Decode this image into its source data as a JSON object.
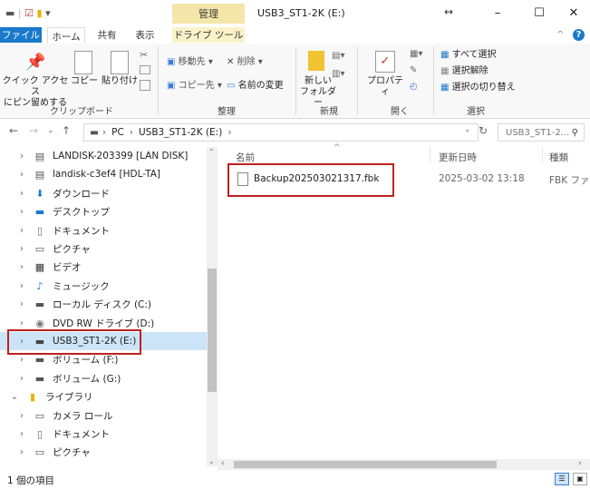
{
  "titlebar": {
    "manage_tab": "管理",
    "window_title": "USB3_ST1-2K (E:)",
    "min": "–",
    "max": "☐",
    "close": "✕",
    "resize_arrows": "↔"
  },
  "ribbon_tabs": {
    "file": "ファイル",
    "home": "ホーム",
    "share": "共有",
    "view": "表示",
    "drive_tools": "ドライブ ツール",
    "help": "?"
  },
  "ribbon": {
    "clipboard": {
      "pin_line1": "クイック アクセス",
      "pin_line2": "にピン留めする",
      "copy": "コピー",
      "paste": "貼り付け",
      "group": "クリップボード"
    },
    "organize": {
      "move_to": "移動先",
      "copy_to": "コピー先",
      "delete": "削除",
      "rename": "名前の変更",
      "group": "整理"
    },
    "new": {
      "new_folder_line1": "新しい",
      "new_folder_line2": "フォルダー",
      "group": "新規"
    },
    "open": {
      "properties": "プロパティ",
      "group": "開く"
    },
    "select": {
      "select_all": "すべて選択",
      "select_none": "選択解除",
      "invert": "選択の切り替え",
      "group": "選択"
    }
  },
  "address": {
    "crumb_pc": "PC",
    "crumb_drive": "USB3_ST1-2K (E:)",
    "search_placeholder": "USB3_ST1-2..."
  },
  "nav": {
    "items": [
      {
        "label": "LANDISK-203399 [LAN DISK]",
        "icon": "network-server-icon"
      },
      {
        "label": "landisk-c3ef4 [HDL-TA]",
        "icon": "network-server-icon"
      },
      {
        "label": "ダウンロード",
        "icon": "download-arrow-icon"
      },
      {
        "label": "デスクトップ",
        "icon": "desktop-icon"
      },
      {
        "label": "ドキュメント",
        "icon": "document-icon"
      },
      {
        "label": "ピクチャ",
        "icon": "picture-icon"
      },
      {
        "label": "ビデオ",
        "icon": "video-icon"
      },
      {
        "label": "ミュージック",
        "icon": "music-note-icon"
      },
      {
        "label": "ローカル ディスク (C:)",
        "icon": "local-disk-icon"
      },
      {
        "label": "DVD RW ドライブ (D:)",
        "icon": "dvd-drive-icon"
      },
      {
        "label": "USB3_ST1-2K (E:)",
        "icon": "usb-drive-icon"
      },
      {
        "label": "ボリューム (F:)",
        "icon": "drive-icon"
      },
      {
        "label": "ボリューム (G:)",
        "icon": "drive-icon"
      },
      {
        "label": "ライブラリ",
        "icon": "library-icon"
      },
      {
        "label": "カメラ ロール",
        "icon": "camera-roll-icon"
      },
      {
        "label": "ドキュメント",
        "icon": "document-icon"
      },
      {
        "label": "ピクチャ",
        "icon": "picture-icon"
      }
    ]
  },
  "columns": {
    "name": "名前",
    "modified": "更新日時",
    "type": "種類"
  },
  "files": [
    {
      "name": "Backup202503021317.fbk",
      "modified": "2025-03-02 13:18",
      "type": "FBK ファイル"
    }
  ],
  "status": {
    "count": "1 個の項目"
  },
  "colors": {
    "file_tab": "#1979ca",
    "manage_tab": "#f4e6a9",
    "selection": "#cce4f7",
    "highlight_box": "#c0201f"
  }
}
